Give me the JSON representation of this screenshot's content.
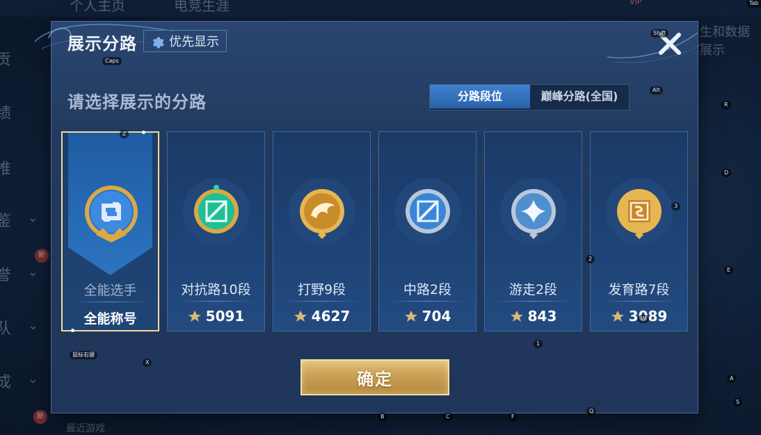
{
  "background": {
    "top_left_1": "个人主页",
    "top_left_2": "电竞生涯",
    "vip_badge": "VIP",
    "right_text": "生和数据展示",
    "side_items": [
      "贡",
      "绩",
      "推",
      "鉴",
      "誉",
      "队",
      "成"
    ],
    "new_badge": "新",
    "bottom_text": "最近游戏"
  },
  "dialog": {
    "title": "展示分路",
    "priority_button": "优先显示",
    "subtitle": "请选择展示的分路",
    "tabs": [
      {
        "label": "分路段位",
        "active": true
      },
      {
        "label": "巅峰分路(全国)",
        "active": false
      }
    ],
    "cards": [
      {
        "label": "全能选手",
        "value": "全能称号",
        "selected": true,
        "emblem": "all-round-emblem-icon",
        "color": "#5aa9f0"
      },
      {
        "label": "对抗路10段",
        "value": "5091",
        "selected": false,
        "emblem": "clash-lane-emblem-icon",
        "color": "#2fd1a8"
      },
      {
        "label": "打野9段",
        "value": "4627",
        "selected": false,
        "emblem": "jungle-emblem-icon",
        "color": "#e8b24a"
      },
      {
        "label": "中路2段",
        "value": "704",
        "selected": false,
        "emblem": "mid-lane-emblem-icon",
        "color": "#6fb2f2"
      },
      {
        "label": "游走2段",
        "value": "843",
        "selected": false,
        "emblem": "roam-emblem-icon",
        "color": "#9ec6f0"
      },
      {
        "label": "发育路7段",
        "value": "3089",
        "selected": false,
        "emblem": "farm-lane-emblem-icon",
        "color": "#e8a050"
      }
    ],
    "confirm_button": "确定"
  },
  "key_hints": {
    "caps": "Caps",
    "tab": "Tab",
    "shift": "Shift",
    "alt": "Alt",
    "z": "Z",
    "x": "X",
    "r": "R",
    "d": "D",
    "e": "E",
    "three": "3",
    "two": "2",
    "one": "1",
    "w": "W",
    "a": "A",
    "s": "S",
    "b": "B",
    "c": "C",
    "f": "F",
    "q": "Q",
    "mouse_right": "鼠标右键"
  },
  "colors": {
    "accent_gold": "#f3d9a0",
    "tab_active": "#3f82d0",
    "dialog_bg": "#213a5f"
  }
}
